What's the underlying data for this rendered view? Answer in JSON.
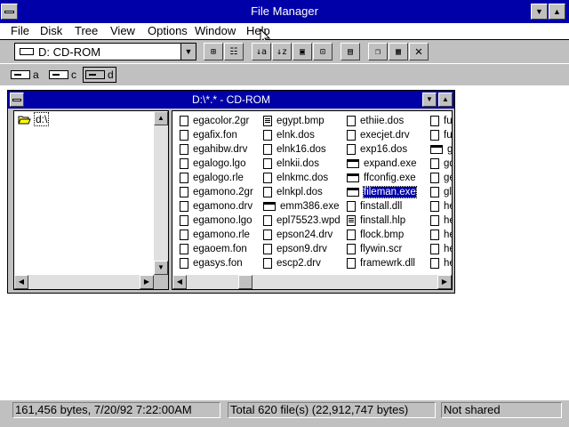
{
  "window": {
    "title": "File Manager"
  },
  "menu": [
    {
      "label": "File"
    },
    {
      "label": "Disk"
    },
    {
      "label": "Tree"
    },
    {
      "label": "View"
    },
    {
      "label": "Options"
    },
    {
      "label": "Window"
    },
    {
      "label": "Help"
    }
  ],
  "toolbar": {
    "drive_combo_value": "D: CD-ROM"
  },
  "drives": [
    {
      "letter": "a",
      "icon": "floppy-drive-icon"
    },
    {
      "letter": "c",
      "icon": "hard-drive-icon"
    },
    {
      "letter": "d",
      "icon": "cdrom-drive-icon",
      "selected": true
    }
  ],
  "child_window": {
    "title": "D:\\*.* - CD-ROM",
    "tree": {
      "root": "d:\\"
    },
    "columns": [
      [
        "egacolor.2gr",
        "egafix.fon",
        "egahibw.drv",
        "egalogo.lgo",
        "egalogo.rle",
        "egamono.2gr",
        "egamono.drv",
        "egamono.lgo",
        "egamono.rle",
        "egaoem.fon",
        "egasys.fon"
      ],
      [
        "egypt.bmp",
        "elnk.dos",
        "elnk16.dos",
        "elnkii.dos",
        "elnkmc.dos",
        "elnkpl.dos",
        "emm386.exe",
        "epl75523.wpd",
        "epson24.drv",
        "epson9.drv",
        "escp2.drv"
      ],
      [
        "ethiie.dos",
        "execjet.drv",
        "exp16.dos",
        "expand.exe",
        "ffconfig.exe",
        "fileman.exe",
        "finstall.dll",
        "finstall.hlp",
        "flock.bmp",
        "flywin.scr",
        "framewrk.dll"
      ],
      [
        "fuji",
        "fuji",
        "gd",
        "gd",
        "ge",
        "glc",
        "he",
        "he",
        "he",
        "he",
        "he"
      ]
    ],
    "icon_types": [
      [
        "file",
        "file",
        "file",
        "file",
        "file",
        "file",
        "file",
        "file",
        "file",
        "file",
        "file"
      ],
      [
        "doc",
        "file",
        "file",
        "file",
        "file",
        "file",
        "exe",
        "file",
        "file",
        "file",
        "file"
      ],
      [
        "file",
        "file",
        "file",
        "exe",
        "exe",
        "exe",
        "file",
        "doc",
        "file",
        "file",
        "file"
      ],
      [
        "file",
        "file",
        "exe",
        "file",
        "file",
        "file",
        "file",
        "file",
        "file",
        "file",
        "file"
      ]
    ],
    "selected_file": "fileman.exe"
  },
  "status": {
    "selection": "161,456 bytes, 7/20/92 7:22:00AM",
    "totals": "Total 620 file(s) (22,912,747 bytes)",
    "sharing": "Not shared"
  },
  "colors": {
    "titlebar": "#0000a8",
    "face": "#c0c0c0"
  }
}
